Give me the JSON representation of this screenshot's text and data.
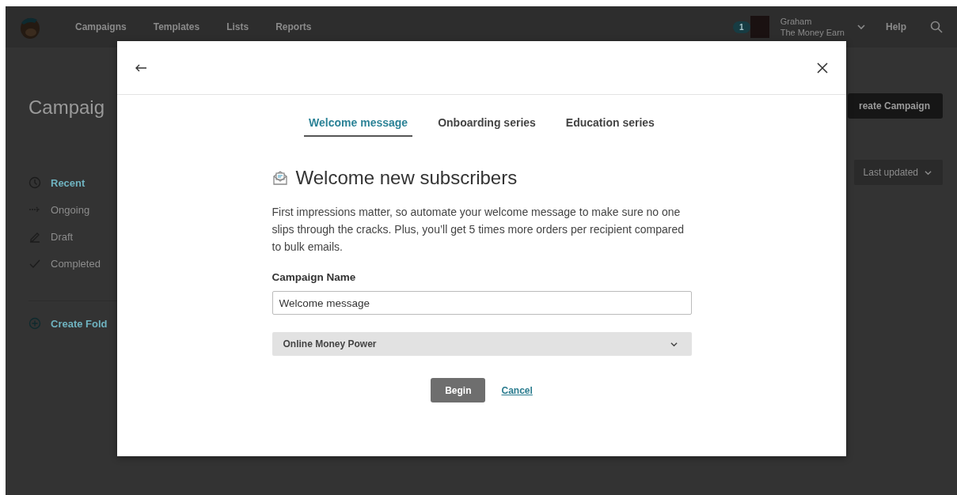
{
  "nav": {
    "links": [
      "Campaigns",
      "Templates",
      "Lists",
      "Reports"
    ],
    "notification_count": "1",
    "user_name": "Graham",
    "account_name": "The Money Earn",
    "help": "Help"
  },
  "page": {
    "title": "Campaig",
    "create_button": "reate Campaign",
    "sort": "Last updated",
    "sidebar": [
      {
        "label": "Recent",
        "kind": "clock",
        "selected": true
      },
      {
        "label": "Ongoing",
        "kind": "arrow",
        "selected": false
      },
      {
        "label": "Draft",
        "kind": "pencil",
        "selected": false
      },
      {
        "label": "Completed",
        "kind": "check",
        "selected": false
      }
    ],
    "create_folder": "Create Fold"
  },
  "modal": {
    "tabs": [
      {
        "label": "Welcome message",
        "selected": true
      },
      {
        "label": "Onboarding series",
        "selected": false
      },
      {
        "label": "Education series",
        "selected": false
      }
    ],
    "heading": "Welcome new subscribers",
    "description": "First impressions matter, so automate your welcome message to make sure no one slips through the cracks. Plus, you’ll get 5 times more orders per recipient compared to bulk emails.",
    "field_label": "Campaign Name",
    "field_value": "Welcome message",
    "list_select": "Online Money Power",
    "begin": "Begin",
    "cancel": "Cancel"
  }
}
